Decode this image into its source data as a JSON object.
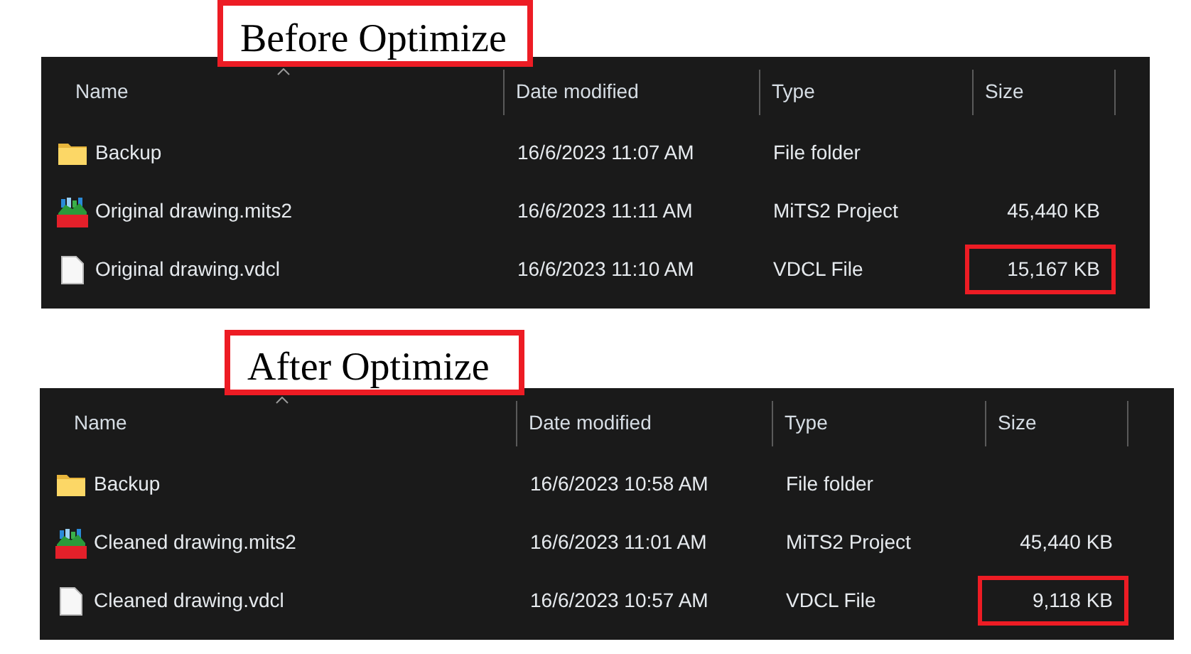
{
  "sections": [
    {
      "caption": "Before Optimize",
      "columns": [
        "Name",
        "Date modified",
        "Type",
        "Size"
      ],
      "rows": [
        {
          "kind": "folder",
          "name": "Backup",
          "date": "16/6/2023 11:07 AM",
          "type": "File folder",
          "size_highlighted": false
        },
        {
          "kind": "mits",
          "name": "Original drawing.mits2",
          "date": "16/6/2023 11:11 AM",
          "type": "MiTS2 Project",
          "size": "45,440 KB",
          "size_highlighted": false
        },
        {
          "kind": "file",
          "name": "Original drawing.vdcl",
          "date": "16/6/2023 11:10 AM",
          "type": "VDCL File",
          "size": "15,167 KB",
          "size_highlighted": true
        }
      ]
    },
    {
      "caption": "After Optimize",
      "columns": [
        "Name",
        "Date modified",
        "Type",
        "Size"
      ],
      "rows": [
        {
          "kind": "folder",
          "name": "Backup",
          "date": "16/6/2023 10:58 AM",
          "type": "File folder",
          "size_highlighted": false
        },
        {
          "kind": "mits",
          "name": "Cleaned drawing.mits2",
          "date": "16/6/2023 11:01 AM",
          "type": "MiTS2 Project",
          "size": "45,440 KB",
          "size_highlighted": false
        },
        {
          "kind": "file",
          "name": "Cleaned drawing.vdcl",
          "date": "16/6/2023 10:57 AM",
          "type": "VDCL File",
          "size": "9,118 KB",
          "size_highlighted": true
        }
      ]
    }
  ]
}
